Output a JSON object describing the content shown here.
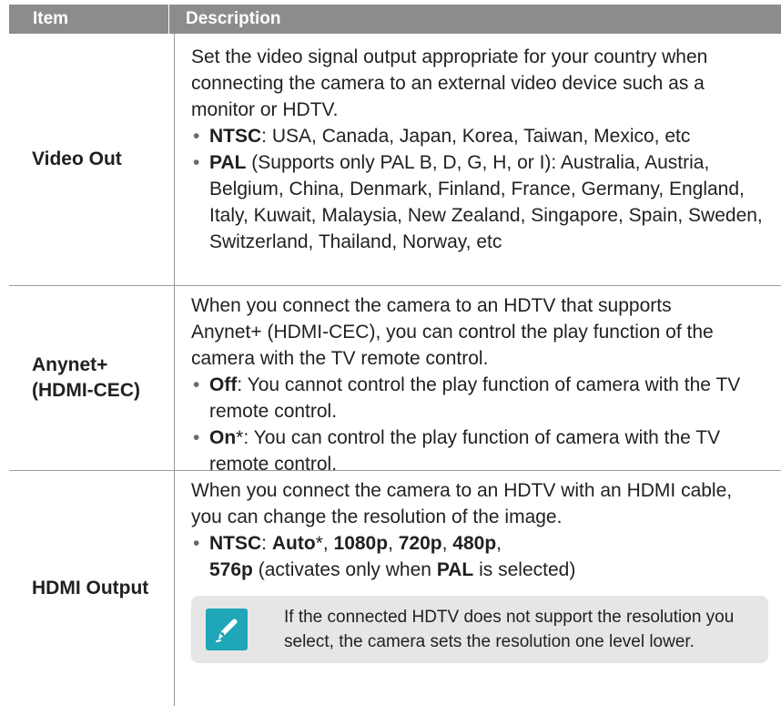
{
  "header": {
    "item": "Item",
    "description": "Description"
  },
  "rows": [
    {
      "item": "Video Out",
      "intro": "Set the video signal output appropriate for your country when connecting the camera to an external video device such as a monitor or HDTV.",
      "bullets": [
        {
          "label": "NTSC",
          "text": ": USA, Canada, Japan, Korea, Taiwan, Mexico, etc"
        },
        {
          "label": "PAL",
          "text": " (Supports only PAL B, D, G, H, or I): Australia, Austria, Belgium, China, Denmark, Finland, France, Germany, England, Italy, Kuwait, Malaysia, New Zealand, Singapore, Spain, Sweden, Switzerland, Thailand, Norway, etc"
        }
      ]
    },
    {
      "item_line1": "Anynet+",
      "item_line2": "(HDMI-CEC)",
      "intro": "When you connect the camera to an HDTV that supports Anynet+ (HDMI-CEC), you can control the play function of the camera with the TV remote control.",
      "bullets": [
        {
          "label": "Off",
          "text": ": You cannot control the play function of camera with the TV remote control."
        },
        {
          "label": "On",
          "text": "*: You can control the play function of camera with the TV remote control."
        }
      ]
    },
    {
      "item": "HDMI Output",
      "intro": "When you connect the camera to an HDTV with an HDMI cable, you can change the resolution of the image.",
      "bullet": {
        "label": "NTSC",
        "sep1": ": ",
        "auto": "Auto",
        "star": "*, ",
        "r1080": "1080p",
        "comma1": ", ",
        "r720": "720p",
        "comma2": ", ",
        "r480": "480p",
        "comma3": ",",
        "r576": "576p",
        "tail1": " (activates only when ",
        "pal": "PAL",
        "tail2": " is selected)"
      },
      "note": "If the connected HDTV does not support the resolution you select, the camera sets the resolution one level lower."
    }
  ],
  "icons": {
    "note": "pen-note-icon"
  },
  "colors": {
    "header_bg": "#8c8c8c",
    "note_bg": "#e6e6e6",
    "note_icon": "#1fa6b8"
  }
}
